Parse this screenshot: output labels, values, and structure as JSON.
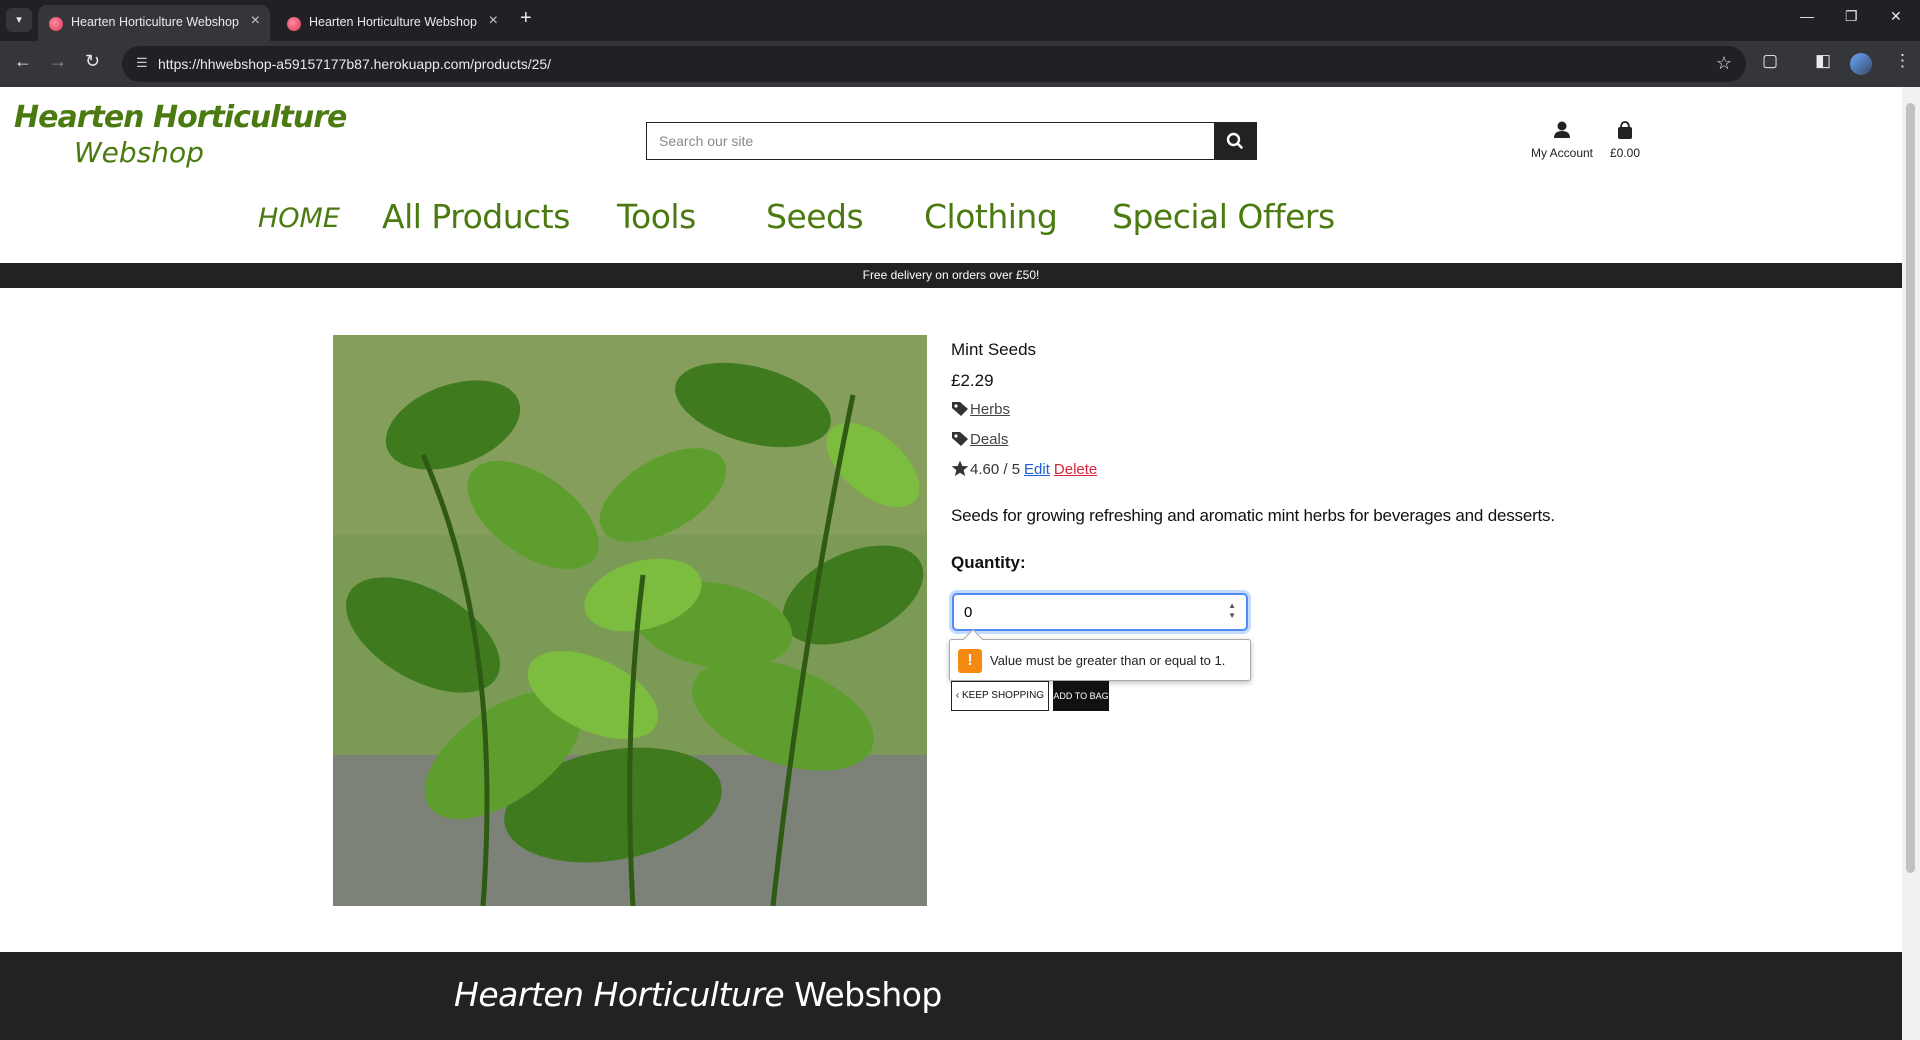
{
  "browser": {
    "tabs": [
      {
        "title": "Hearten Horticulture Webshop",
        "active": true
      },
      {
        "title": "Hearten Horticulture Webshop",
        "active": false
      }
    ],
    "url": "https://hhwebshop-a59157177b87.herokuapp.com/products/25/"
  },
  "header": {
    "logo_line1": "Hearten Horticulture",
    "logo_line2": "Webshop",
    "search_placeholder": "Search our site",
    "account_label": "My Account",
    "bag_total": "£0.00"
  },
  "nav": {
    "home": "HOME",
    "all_products": "All Products",
    "tools": "Tools",
    "seeds": "Seeds",
    "clothing": "Clothing",
    "special_offers": "Special Offers"
  },
  "banner": "Free delivery on orders over £50!",
  "product": {
    "name": "Mint Seeds",
    "price": "£2.29",
    "category": "Herbs",
    "tag": "Deals",
    "rating": "4.60 / 5",
    "edit_label": "Edit",
    "delete_label": "Delete",
    "description": "Seeds for growing refreshing and aromatic mint herbs for beverages and desserts.",
    "quantity_label": "Quantity:",
    "quantity_value": "0",
    "validation_message": "Value must be greater than or equal to 1.",
    "keep_shopping_label": "KEEP SHOPPING",
    "add_to_bag_label": "ADD TO BAG"
  },
  "footer": {
    "logo_bold": "Hearten Horticulture",
    "logo_light": "Webshop"
  },
  "colors": {
    "brand_green": "#4a7a10",
    "dark": "#222222",
    "edit_link": "#1a5fd6",
    "delete_link": "#d6243a",
    "warning": "#f48a12"
  }
}
